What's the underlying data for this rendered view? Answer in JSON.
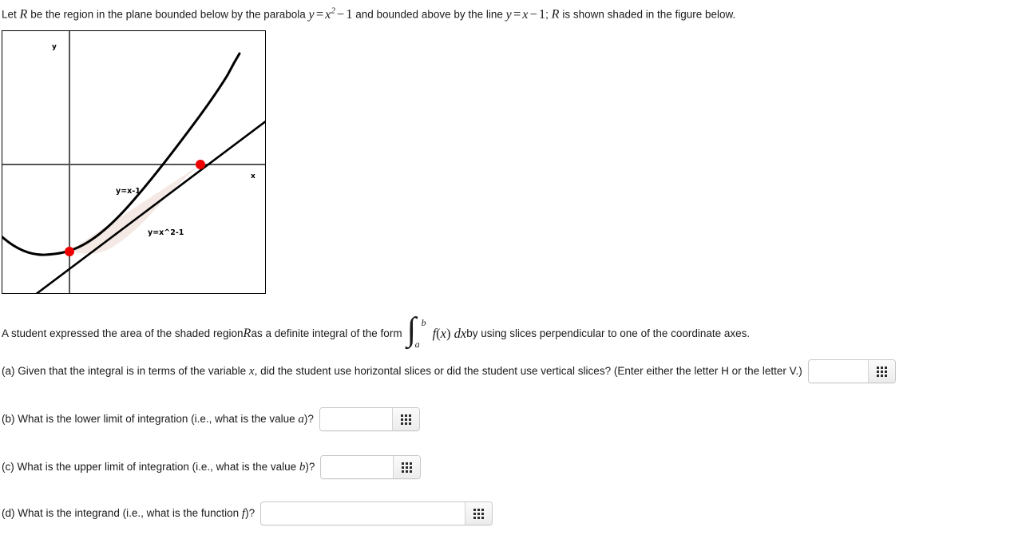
{
  "intro": {
    "prefix": "Let ",
    "region_var": "R",
    "mid1": " be the region in the plane bounded below by the parabola ",
    "parabola_eq": "y = x² − 1",
    "mid2": " and bounded above by the line ",
    "line_eq": "y = x − 1",
    "semicolon": "; ",
    "region_var2": "R",
    "suffix": " is shown shaded in the figure below."
  },
  "figure": {
    "name": "region-plot",
    "x_axis_label": "x",
    "y_axis_label": "y",
    "line_curve_label": "y=x-1",
    "parabola_curve_label": "y=x^2-1",
    "shade_color": "#f4e9e4",
    "curve_color": "#000000",
    "axis_color": "#555555",
    "point_color": "#ee0000",
    "border_color": "#000000"
  },
  "statement": {
    "part1": "A student expressed the area of the shaded region ",
    "region_var": "R",
    "part2": " as a definite integral of the form ",
    "integral_sign": "∫",
    "lower_limit": "a",
    "upper_limit": "b",
    "integrand": "f(x) dx",
    "part3": " by using slices perpendicular to one of the coordinate axes."
  },
  "questions": [
    {
      "id": "a",
      "label": "(a) Given that the integral is in terms of the variable ",
      "var": "x",
      "label_after": ", did the student use horizontal slices or did the student use vertical slices? (Enter either the letter H or the letter V.)",
      "value": "",
      "placeholder": "",
      "input_name": "answer-input-a",
      "keypad_name": "keypad-button-a"
    },
    {
      "id": "b",
      "label": "(b) What is the lower limit of integration (i.e., what is the value ",
      "var": "a",
      "label_after": ")?",
      "value": "",
      "placeholder": "",
      "input_name": "answer-input-b",
      "keypad_name": "keypad-button-b"
    },
    {
      "id": "c",
      "label": "(c) What is the upper limit of integration (i.e., what is the value ",
      "var": "b",
      "label_after": ")?",
      "value": "",
      "placeholder": "",
      "input_name": "answer-input-c",
      "keypad_name": "keypad-button-c"
    },
    {
      "id": "d",
      "label": "(d) What is the integrand (i.e., what is the function ",
      "var": "f",
      "label_after": ")?",
      "value": "",
      "placeholder": "",
      "input_name": "answer-input-d",
      "keypad_name": "keypad-button-d"
    }
  ]
}
